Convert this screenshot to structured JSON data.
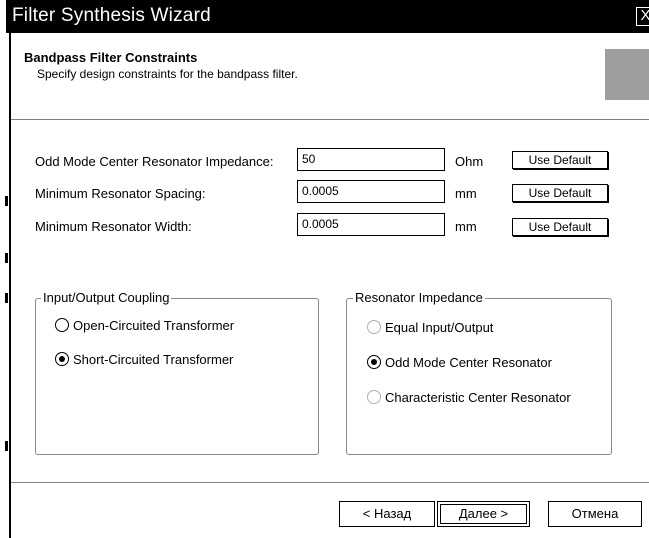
{
  "window": {
    "title": "Filter Synthesis Wizard",
    "close_glyph": "X"
  },
  "header": {
    "title": "Bandpass Filter Constraints",
    "subtitle": "Specify design constraints for the bandpass filter."
  },
  "fields": [
    {
      "label": "Odd Mode Center Resonator Impedance:",
      "value": "50",
      "unit": "Ohm",
      "button": "Use Default"
    },
    {
      "label": "Minimum Resonator Spacing:",
      "value": "0.0005",
      "unit": "mm",
      "button": "Use Default"
    },
    {
      "label": "Minimum Resonator Width:",
      "value": "0.0005",
      "unit": "mm",
      "button": "Use Default"
    }
  ],
  "io_coupling": {
    "legend": "Input/Output Coupling",
    "options": [
      {
        "label": "Open-Circuited Transformer",
        "selected": false,
        "enabled": true
      },
      {
        "label": "Short-Circuited Transformer",
        "selected": true,
        "enabled": true
      }
    ]
  },
  "resonator_impedance": {
    "legend": "Resonator Impedance",
    "options": [
      {
        "label": "Equal Input/Output",
        "selected": false,
        "enabled": false
      },
      {
        "label": "Odd Mode Center Resonator",
        "selected": true,
        "enabled": true
      },
      {
        "label": "Characteristic Center Resonator",
        "selected": false,
        "enabled": false
      }
    ]
  },
  "nav": {
    "back_label": "< Назад",
    "next_label": "Далее >",
    "cancel_label": "Отмена"
  }
}
